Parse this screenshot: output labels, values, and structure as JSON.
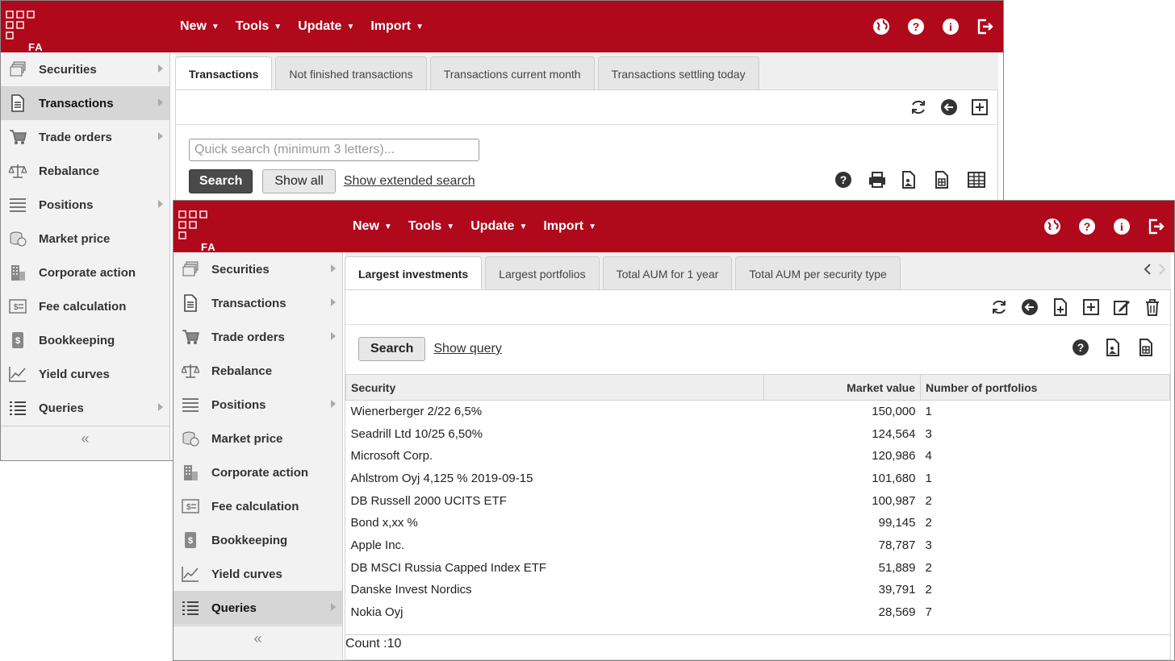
{
  "menu": [
    {
      "label": "New"
    },
    {
      "label": "Tools"
    },
    {
      "label": "Update"
    },
    {
      "label": "Import"
    }
  ],
  "logo_text": "FA",
  "sidebar": {
    "items": [
      {
        "label": "Securities",
        "icon": "securities-icon",
        "has_submenu": true
      },
      {
        "label": "Transactions",
        "icon": "document-icon",
        "has_submenu": true
      },
      {
        "label": "Trade orders",
        "icon": "cart-icon",
        "has_submenu": true
      },
      {
        "label": "Rebalance",
        "icon": "scale-icon",
        "has_submenu": false
      },
      {
        "label": "Positions",
        "icon": "list-icon",
        "has_submenu": true
      },
      {
        "label": "Market price",
        "icon": "coins-icon",
        "has_submenu": false
      },
      {
        "label": "Corporate action",
        "icon": "building-icon",
        "has_submenu": false
      },
      {
        "label": "Fee calculation",
        "icon": "fee-icon",
        "has_submenu": false
      },
      {
        "label": "Bookkeeping",
        "icon": "ledger-icon",
        "has_submenu": false
      },
      {
        "label": "Yield curves",
        "icon": "line-chart-icon",
        "has_submenu": false
      },
      {
        "label": "Queries",
        "icon": "queries-icon",
        "has_submenu": true
      }
    ],
    "collapse_label": "«"
  },
  "back_window": {
    "active_sidebar": "Transactions",
    "tabs": [
      {
        "label": "Transactions",
        "active": true
      },
      {
        "label": "Not finished transactions",
        "active": false
      },
      {
        "label": "Transactions current month",
        "active": false
      },
      {
        "label": "Transactions settling today",
        "active": false
      }
    ],
    "search": {
      "placeholder": "Quick search (minimum 3 letters)...",
      "search_label": "Search",
      "show_all_label": "Show all",
      "extended_label": "Show extended search"
    }
  },
  "front_window": {
    "active_sidebar": "Queries",
    "tabs": [
      {
        "label": "Largest investments",
        "active": true
      },
      {
        "label": "Largest portfolios",
        "active": false
      },
      {
        "label": "Total AUM for 1 year",
        "active": false
      },
      {
        "label": "Total AUM per security type",
        "active": false
      }
    ],
    "search_label": "Search",
    "show_query_label": "Show query",
    "table": {
      "columns": [
        "Security",
        "Market value",
        "Number of portfolios"
      ],
      "rows": [
        [
          "Wienerberger 2/22 6,5%",
          "150,000",
          "1"
        ],
        [
          "Seadrill Ltd 10/25 6,50%",
          "124,564",
          "3"
        ],
        [
          "Microsoft Corp.",
          "120,986",
          "4"
        ],
        [
          "Ahlstrom Oyj 4,125 % 2019-09-15",
          "101,680",
          "1"
        ],
        [
          "DB Russell 2000 UCITS ETF",
          "100,987",
          "2"
        ],
        [
          "Bond x,xx %",
          "99,145",
          "2"
        ],
        [
          "Apple Inc.",
          "78,787",
          "3"
        ],
        [
          "DB MSCI Russia Capped Index ETF",
          "51,889",
          "2"
        ],
        [
          "Danske Invest Nordics",
          "39,791",
          "2"
        ],
        [
          "Nokia Oyj",
          "28,569",
          "7"
        ]
      ]
    },
    "count_label": "Count :10"
  },
  "colors": {
    "brand_red": "#b0091c",
    "sidebar_bg": "#f2f2f2",
    "active_item_bg": "#d6d6d6"
  }
}
